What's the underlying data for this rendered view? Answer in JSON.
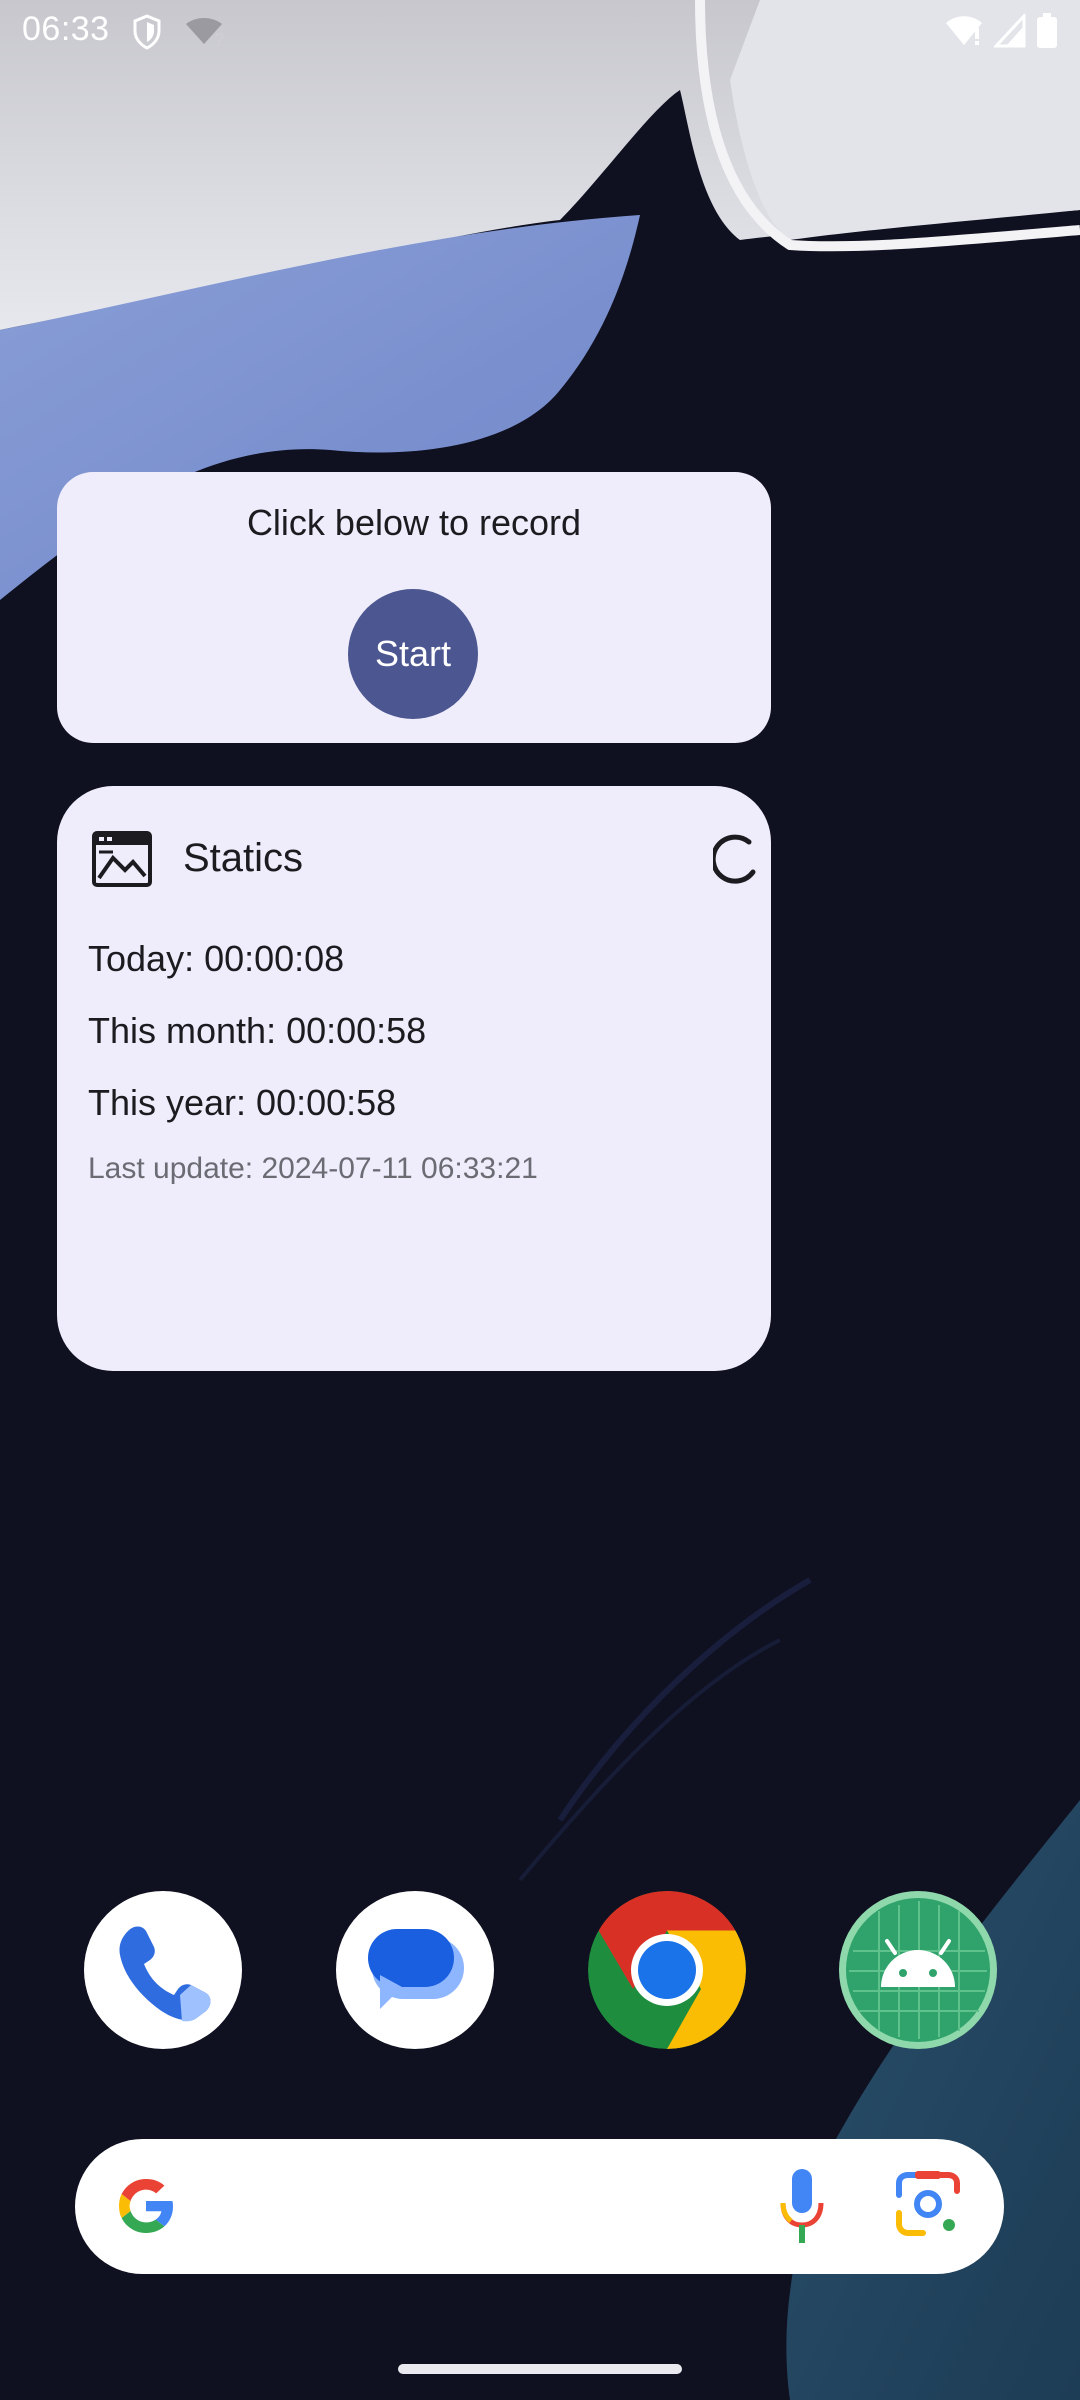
{
  "status_bar": {
    "time": "06:33",
    "icons": [
      "shield-icon",
      "wifi-no-internet-icon",
      "wifi-icon",
      "signal-icon",
      "battery-icon"
    ]
  },
  "record_widget": {
    "title": "Click below to record",
    "start_label": "Start"
  },
  "statics_widget": {
    "title": "Statics",
    "today": "Today: 00:00:08",
    "this_month": "This month: 00:00:58",
    "this_year": "This year: 00:00:58",
    "last_update": "Last update: 2024-07-11 06:33:21"
  },
  "dock": {
    "apps": [
      "phone-app",
      "messages-app",
      "chrome-app",
      "android-app"
    ]
  },
  "search": {
    "icons": [
      "google-g-icon",
      "mic-icon",
      "lens-icon"
    ]
  },
  "colors": {
    "widget_bg": "#efedfb",
    "start_button": "#4c5690",
    "wallpaper_dark": "#0f1020"
  }
}
